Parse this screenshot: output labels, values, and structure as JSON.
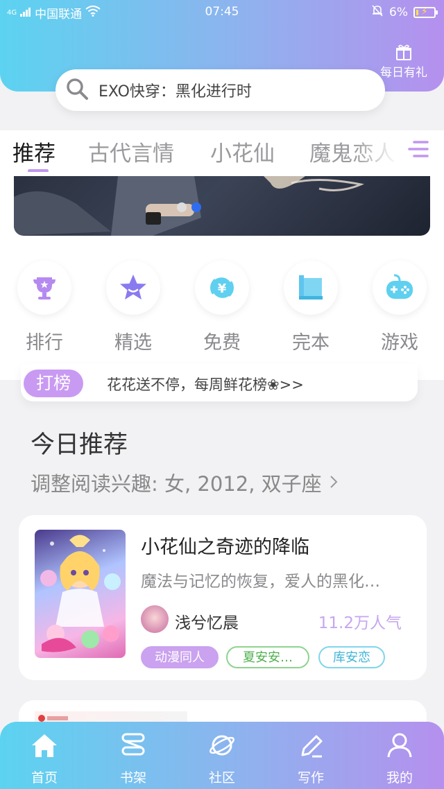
{
  "status_bar": {
    "network": "4G",
    "carrier": "中国联通",
    "time": "07:45",
    "battery": "6%"
  },
  "header": {
    "daily_gift_label": "每日有礼",
    "gradient_colors": [
      "#5cd3f0",
      "#8fb2ee",
      "#b590ee"
    ]
  },
  "search": {
    "placeholder": "EXO快穿：黑化进行时"
  },
  "tabs": [
    {
      "label": "推荐",
      "active": true
    },
    {
      "label": "古代言情",
      "active": false
    },
    {
      "label": "小花仙",
      "active": false
    },
    {
      "label": "魔鬼恋人",
      "active": false
    }
  ],
  "banner": {
    "slides": 2,
    "active_index": 1
  },
  "categories": [
    {
      "label": "排行",
      "icon": "trophy-icon"
    },
    {
      "label": "精选",
      "icon": "star-icon"
    },
    {
      "label": "免费",
      "icon": "yen-icon"
    },
    {
      "label": "完本",
      "icon": "book-icon"
    },
    {
      "label": "游戏",
      "icon": "gamepad-icon"
    }
  ],
  "promo": {
    "badge": "打榜",
    "text": "花花送不停，每周鲜花榜❀>>"
  },
  "today": {
    "title": "今日推荐",
    "subtitle": "调整阅读兴趣: 女, 2012, 双子座"
  },
  "featured_book": {
    "title": "小花仙之奇迹的降临",
    "description": "魔法与记忆的恢复，爱人的黑化…",
    "author": "浅兮忆晨",
    "popularity": "11.2万人气",
    "tags": [
      "动漫同人",
      "夏安安…",
      "库安恋"
    ]
  },
  "bottom_nav": [
    {
      "label": "首页",
      "icon": "home-icon",
      "active": true
    },
    {
      "label": "书架",
      "icon": "bookshelf-icon",
      "active": false
    },
    {
      "label": "社区",
      "icon": "planet-icon",
      "active": false
    },
    {
      "label": "写作",
      "icon": "pen-icon",
      "active": false
    },
    {
      "label": "我的",
      "icon": "user-icon",
      "active": false
    }
  ]
}
